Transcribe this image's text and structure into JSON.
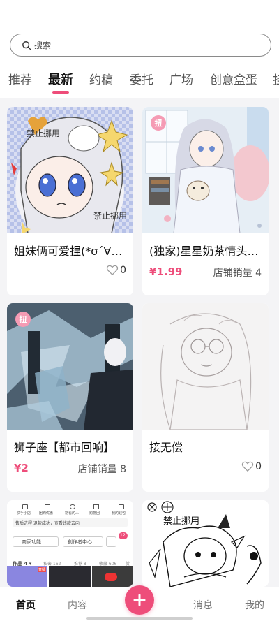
{
  "search": {
    "placeholder": "搜索"
  },
  "tabs": [
    "推荐",
    "最新",
    "约稿",
    "委托",
    "广场",
    "创意盒蛋",
    "挂"
  ],
  "cards": [
    {
      "title": "姐妹俩可爱捏(*σ´∀`)σ",
      "likes": "0",
      "watermark": "禁止挪用"
    },
    {
      "title": "(独家)星星奶茶情头…",
      "price": "¥1.99",
      "sales": "店铺销量 4",
      "badge": "扭"
    },
    {
      "title": "狮子座【都市回响】",
      "price": "¥2",
      "sales": "店铺销量 8",
      "badge": "扭"
    },
    {
      "title": "接无偿",
      "likes": "0"
    },
    {
      "mini": {
        "icons": [
          "快手小店",
          "团购优惠",
          "常看的人",
          "购物团",
          "我的钱包"
        ],
        "line": "售后进程 退款成功，查看钱款去向",
        "btn1": "商家功能",
        "btn2": "创作者中心",
        "works": "作品 4 ▾",
        "private": "私密 162",
        "recommend": "推荐 8",
        "collect": "收藏 606",
        "liked": "赞",
        "tag": "直播",
        "count": "12"
      }
    },
    {
      "watermark": "禁止挪用"
    }
  ],
  "bottom_nav": [
    "首页",
    "内容",
    "消息",
    "我的"
  ]
}
